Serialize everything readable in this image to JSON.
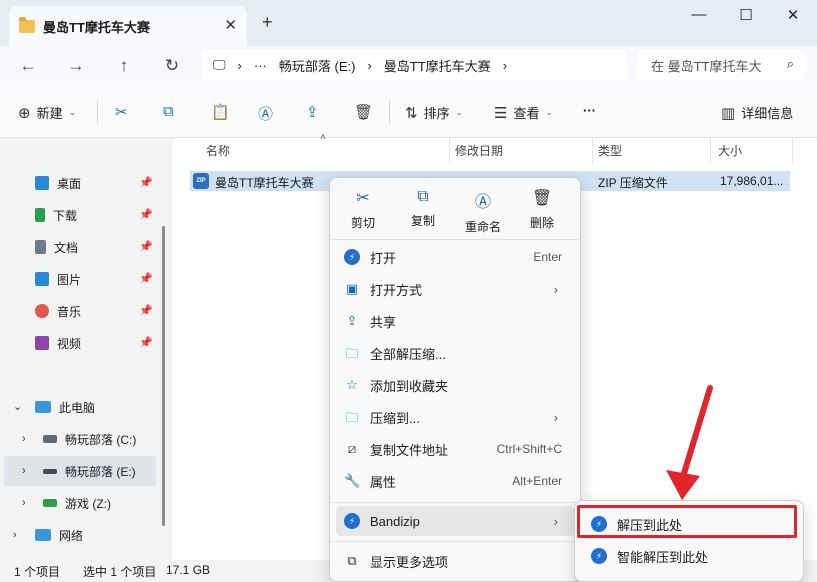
{
  "window": {
    "tab_title": "曼岛TT摩托车大赛",
    "new_tab": "+",
    "close_tab": "✕",
    "minimize": "—",
    "maximize": "☐",
    "close": "✕"
  },
  "nav": {
    "back": "←",
    "forward": "→",
    "up": "↑",
    "refresh": "↻",
    "breadcrumb": [
      "畅玩部落 (E:)",
      "曼岛TT摩托车大赛"
    ],
    "search_placeholder": "在 曼岛TT摩托车大",
    "ellipsis": "···"
  },
  "toolbar": {
    "new": "新建",
    "sort": "排序",
    "view": "查看",
    "details": "详细信息",
    "more": "···"
  },
  "sidebar": {
    "quick": [
      {
        "label": "桌面",
        "color": "#2b88d8"
      },
      {
        "label": "下载",
        "color": "#2a9d4a"
      },
      {
        "label": "文档",
        "color": "#6b7b8c"
      },
      {
        "label": "图片",
        "color": "#2b88d8"
      },
      {
        "label": "音乐",
        "color": "#e0564a"
      },
      {
        "label": "视频",
        "color": "#8e44ad"
      }
    ],
    "this_pc": "此电脑",
    "drives": [
      "畅玩部落 (C:)",
      "畅玩部落 (E:)",
      "游戏 (Z:)"
    ],
    "network": "网络"
  },
  "columns": {
    "name": "名称",
    "modified": "修改日期",
    "type": "类型",
    "size": "大小"
  },
  "file": {
    "name": "曼岛TT摩托车大赛",
    "type": "ZIP 压缩文件",
    "size": "17,986,01...",
    "icon_text": "ZIP"
  },
  "context_menu": {
    "top_actions": [
      "剪切",
      "复制",
      "重命名",
      "删除"
    ],
    "items": [
      {
        "label": "打开",
        "shortcut": "Enter"
      },
      {
        "label": "打开方式",
        "shortcut": ""
      },
      {
        "label": "共享",
        "shortcut": ""
      },
      {
        "label": "全部解压缩...",
        "shortcut": ""
      },
      {
        "label": "添加到收藏夹",
        "shortcut": ""
      },
      {
        "label": "压缩到...",
        "shortcut": ""
      },
      {
        "label": "复制文件地址",
        "shortcut": "Ctrl+Shift+C"
      },
      {
        "label": "属性",
        "shortcut": "Alt+Enter"
      }
    ],
    "bandizip": "Bandizip",
    "more_options": "显示更多选项"
  },
  "submenu": {
    "extract_here": "解压到此处",
    "smart_extract": "智能解压到此处"
  },
  "status": {
    "count": "1 个项目",
    "selected": "选中 1 个项目",
    "size": "17.1 GB"
  }
}
